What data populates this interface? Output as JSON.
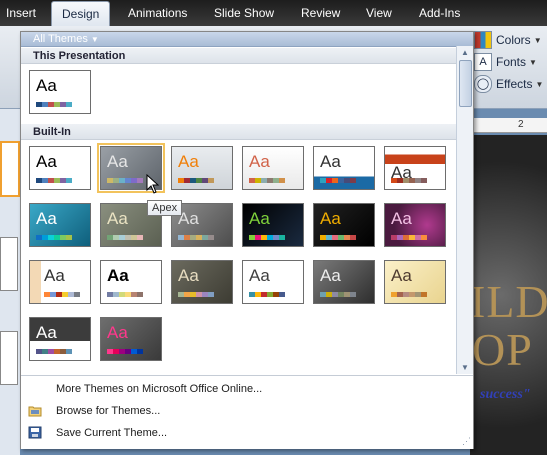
{
  "ribbon": {
    "tabs": [
      "Insert",
      "Design",
      "Animations",
      "Slide Show",
      "Review",
      "View",
      "Add-Ins"
    ],
    "active_tab": "Design",
    "buttons": {
      "colors": "Colors",
      "fonts": "Fonts",
      "effects": "Effects"
    }
  },
  "gallery": {
    "filter_label": "All Themes",
    "section_this": "This Presentation",
    "section_builtin": "Built-In",
    "tooltip": "Apex",
    "aa": "Aa",
    "menu": {
      "more_themes": "More Themes on Microsoft Office Online...",
      "browse": "Browse for Themes...",
      "save": "Save Current Theme..."
    }
  },
  "slide": {
    "line1": "ILD",
    "line2": "OP",
    "tagline": "success\"",
    "ruler_mark": "2"
  },
  "colors": {
    "accent_highlight": "#f2c35c",
    "ribbon_blue": "#a9bcd6"
  }
}
